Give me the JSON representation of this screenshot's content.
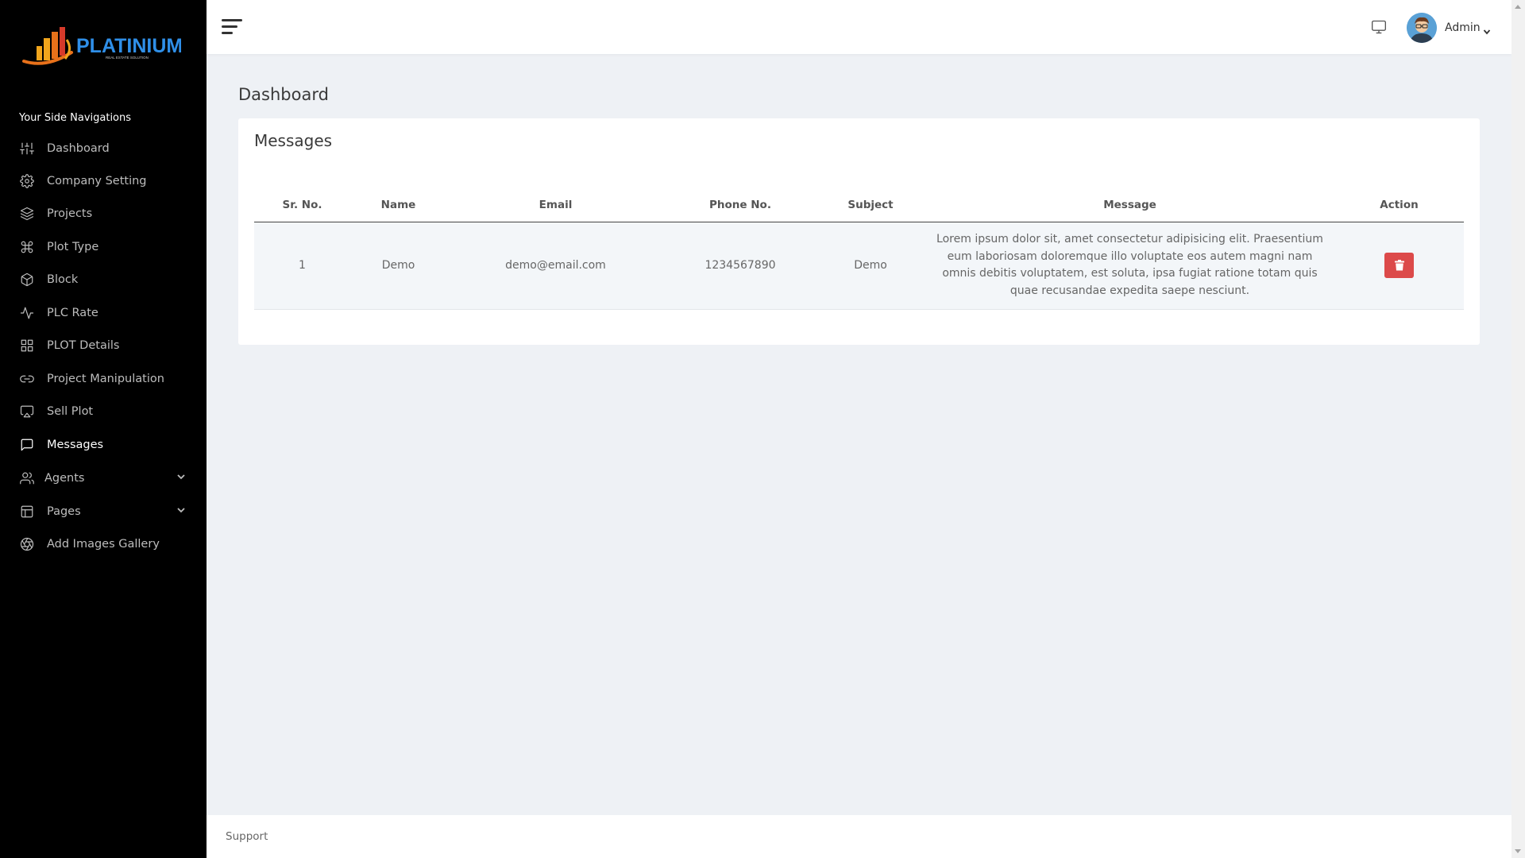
{
  "brand": {
    "name": "PLATINIUM",
    "tagline": "REAL ESTATE SOLUTION",
    "colors": {
      "gold": "#f1a51c",
      "orange": "#e8711a",
      "red": "#d63a2a",
      "blue": "#2f8fe8"
    }
  },
  "sidebar": {
    "heading": "Your Side Navigations",
    "items": [
      {
        "label": "Dashboard",
        "icon": "sliders-icon",
        "active": false
      },
      {
        "label": "Company Setting",
        "icon": "gear-icon",
        "active": false
      },
      {
        "label": "Projects",
        "icon": "layers-icon",
        "active": false
      },
      {
        "label": "Plot Type",
        "icon": "command-icon",
        "active": false
      },
      {
        "label": "Block",
        "icon": "box-icon",
        "active": false
      },
      {
        "label": "PLC Rate",
        "icon": "activity-icon",
        "active": false
      },
      {
        "label": "PLOT Details",
        "icon": "grid-icon",
        "active": false
      },
      {
        "label": "Project Manipulation",
        "icon": "link-icon",
        "active": false
      },
      {
        "label": "Sell Plot",
        "icon": "airplay-icon",
        "active": false
      },
      {
        "label": "Messages",
        "icon": "message-icon",
        "active": true
      },
      {
        "label": "Agents",
        "icon": "users-icon",
        "active": false,
        "expandable": true
      },
      {
        "label": "Pages",
        "icon": "layout-icon",
        "active": false,
        "expandable": true
      },
      {
        "label": "Add Images Gallery",
        "icon": "aperture-icon",
        "active": false
      }
    ]
  },
  "topbar": {
    "menu_icon": "hamburger-icon",
    "monitor_icon": "monitor-icon",
    "user_name": "Admin"
  },
  "page": {
    "title": "Dashboard"
  },
  "card": {
    "title": "Messages",
    "columns": [
      "Sr. No.",
      "Name",
      "Email",
      "Phone No.",
      "Subject",
      "Message",
      "Action"
    ],
    "rows": [
      {
        "sr": "1",
        "name": "Demo",
        "email": "demo@email.com",
        "phone": "1234567890",
        "subject": "Demo",
        "message": "Lorem ipsum dolor sit, amet consectetur adipisicing elit. Praesentium eum laboriosam doloremque illo voluptate eos autem magni nam omnis debitis voluptatem, est soluta, ipsa fugiat ratione totam quis quae recusandae expedita saepe nesciunt.",
        "action_icon": "trash-icon"
      }
    ]
  },
  "footer": {
    "link": "Support"
  }
}
